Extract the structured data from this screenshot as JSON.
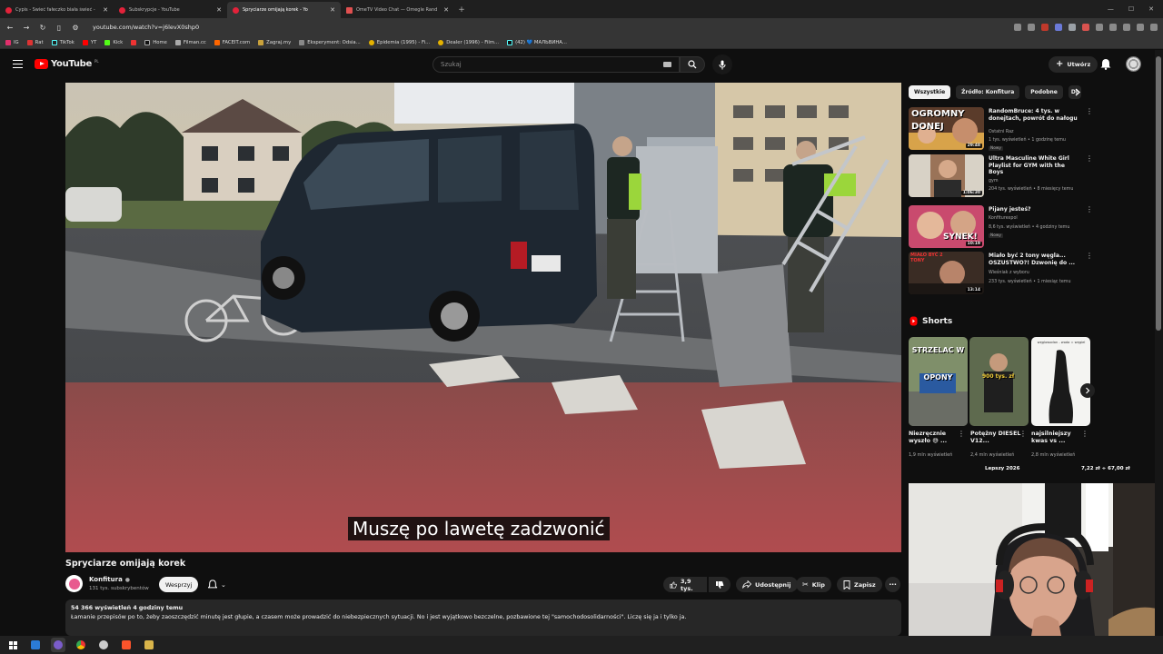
{
  "browser": {
    "tabs": [
      {
        "title": "Cypis - Świeć fałeczko biała świeć - ",
        "active": false
      },
      {
        "title": "Subskrypcje - YouTube",
        "active": false
      },
      {
        "title": "Spryciarze omijają korek - Yo",
        "active": true
      },
      {
        "title": "OmeTV Video Chat — Omegle Rand",
        "active": false
      }
    ],
    "url": "youtube.com/watch?v=j6levX0shp0",
    "bookmarks": [
      "IG",
      "Rat",
      "TikTok",
      "YT",
      "Kick",
      "",
      "Home",
      "Filman.cc",
      "FACEIT.com",
      "Zagraj.my",
      "Eksperyment: Odsia...",
      "Epidemia (1995) - Fi...",
      "Dealer (1996) - Film...",
      "(42) 💙 МАЛЬВИНА..."
    ]
  },
  "header": {
    "logo_text": "YouTube",
    "country": "PL",
    "search_placeholder": "Szukaj",
    "create_label": "Utwórz"
  },
  "video": {
    "subtitle": "Muszę po lawetę zadzwonić",
    "title": "Spryciarze omijają korek",
    "channel": "Konfitura",
    "subscribers": "131 tys. subskrybentów",
    "join_label": "Wesprzyj",
    "likes": "3,9 tys.",
    "share_label": "Udostępnij",
    "clip_label": "Klip",
    "save_label": "Zapisz",
    "stats": "54 366 wyświetleń  4 godziny temu",
    "description": "Łamanie przepisów po to, żeby zaoszczędzić minutę jest głupie, a czasem może prowadzić do niebezpiecznych sytuacji. No i jest wyjątkowo bezczelne, pozbawione tej \"samochodosolidarności\". Liczę się ja i tylko ja."
  },
  "sidebar": {
    "chips": [
      "Wszystkie",
      "Źródło: Konfitura",
      "Podobne",
      "Dl"
    ],
    "recommendations": [
      {
        "title": "RandomBruce: 4 tys. w donejtach, powrót do nałogu",
        "channel": "Ostatni Raz",
        "stats": "1 tys. wyświetleń • 1 godzinę temu",
        "badge": "Nowy",
        "duration": "29:48",
        "thumb_text": "OGROMNY DONEJ"
      },
      {
        "title": "Ultra Masculine White Girl Playlist for GYM with the Boys",
        "channel": "gym",
        "stats": "204 tys. wyświetleń • 8 miesięcy temu",
        "badge": "",
        "duration": "1:06:30",
        "thumb_text": ""
      },
      {
        "title": "Pijany jesteś?",
        "channel": "Konfiturexpol",
        "stats": "8,6 tys. wyświetleń • 4 godziny temu",
        "badge": "Nowy",
        "duration": "10:19",
        "thumb_text": "SYNEK!"
      },
      {
        "title": "Miało być 2 tony węgla... OSZUSTWO?! Dzwonię do ...",
        "channel": "Wieśniak z wyboru",
        "stats": "233 tys. wyświetleń • 1 miesiąc temu",
        "badge": "",
        "duration": "13:14",
        "thumb_text": "MIAŁO BYĆ 2 TONY"
      }
    ],
    "shorts_label": "Shorts",
    "shorts": [
      {
        "title": "Niezręcznie wyszło 😅 ...",
        "views": "1,9 mln wyświetleń",
        "thumb_text": "STRZELAC W OPONY"
      },
      {
        "title": "Potężny DIESEL V12...",
        "views": "2,4 mln wyświetleń",
        "thumb_text": "900 tys. zł"
      },
      {
        "title": "najsilniejszy kwas vs ...",
        "views": "2,8 mln wyświetleń",
        "thumb_text": "węglowodan - woda = węgiel"
      }
    ],
    "overlay_left": "Lepszy 2026",
    "overlay_right": "7,22 zł ÷ 67,00 zł"
  },
  "colors": {
    "yt_red": "#ff0000",
    "background": "#0f0f0f",
    "chip_bg": "#272727"
  }
}
